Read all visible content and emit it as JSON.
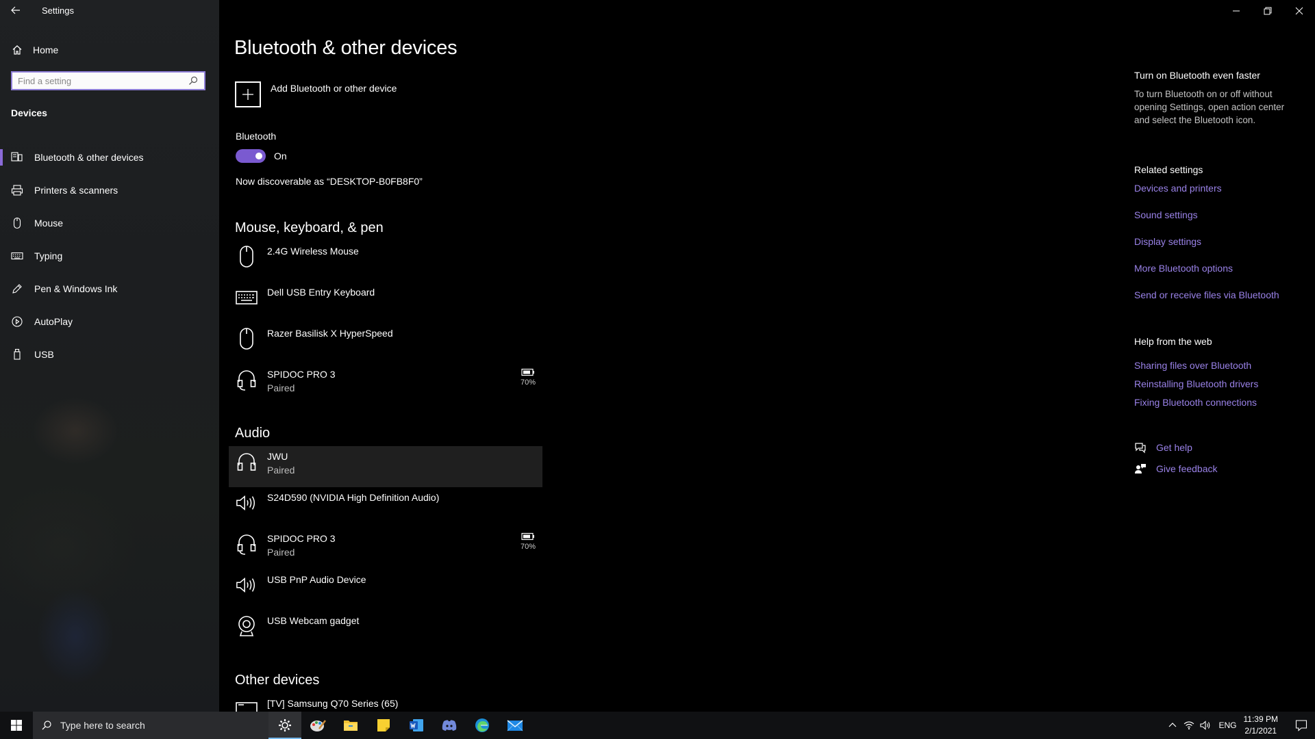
{
  "window": {
    "title": "Settings"
  },
  "sidebar": {
    "home_label": "Home",
    "search_placeholder": "Find a setting",
    "section_label": "Devices",
    "items": [
      {
        "label": "Bluetooth & other devices",
        "icon": "bluetooth-devices-icon",
        "active": true
      },
      {
        "label": "Printers & scanners",
        "icon": "printer-icon"
      },
      {
        "label": "Mouse",
        "icon": "mouse-icon"
      },
      {
        "label": "Typing",
        "icon": "keyboard-icon"
      },
      {
        "label": "Pen & Windows Ink",
        "icon": "pen-icon"
      },
      {
        "label": "AutoPlay",
        "icon": "autoplay-icon"
      },
      {
        "label": "USB",
        "icon": "usb-icon"
      }
    ]
  },
  "main": {
    "title": "Bluetooth & other devices",
    "add_device_label": "Add Bluetooth or other device",
    "bluetooth_label": "Bluetooth",
    "bluetooth_state": "On",
    "discoverable_text": "Now discoverable as “DESKTOP-B0FB8F0”",
    "groups": [
      {
        "title": "Mouse, keyboard, & pen",
        "devices": [
          {
            "name": "2.4G Wireless Mouse",
            "status": "",
            "icon": "mouse-icon"
          },
          {
            "name": "Dell USB Entry Keyboard",
            "status": "",
            "icon": "keyboard-icon"
          },
          {
            "name": "Razer Basilisk X HyperSpeed",
            "status": "",
            "icon": "mouse-icon"
          },
          {
            "name": "SPIDOC PRO 3",
            "status": "Paired",
            "icon": "headset-icon",
            "battery": "70%"
          }
        ]
      },
      {
        "title": "Audio",
        "devices": [
          {
            "name": "JWU",
            "status": "Paired",
            "icon": "headphones-icon"
          },
          {
            "name": "S24D590 (NVIDIA High Definition Audio)",
            "status": "",
            "icon": "speaker-icon"
          },
          {
            "name": "SPIDOC PRO 3",
            "status": "Paired",
            "icon": "headset-icon",
            "battery": "70%"
          },
          {
            "name": "USB PnP Audio Device",
            "status": "",
            "icon": "speaker-icon"
          },
          {
            "name": "USB Webcam gadget",
            "status": "",
            "icon": "webcam-icon"
          }
        ]
      },
      {
        "title": "Other devices",
        "devices": [
          {
            "name": "[TV] Samsung Q70 Series (65)",
            "status": "",
            "icon": "tv-icon"
          }
        ]
      }
    ]
  },
  "right_panel": {
    "tip_title": "Turn on Bluetooth even faster",
    "tip_text": "To turn Bluetooth on or off without opening Settings, open action center and select the Bluetooth icon.",
    "related_title": "Related settings",
    "related_links": [
      "Devices and printers",
      "Sound settings",
      "Display settings",
      "More Bluetooth options",
      "Send or receive files via Bluetooth"
    ],
    "help_title": "Help from the web",
    "help_links": [
      "Sharing files over Bluetooth",
      "Reinstalling Bluetooth drivers",
      "Fixing Bluetooth connections"
    ],
    "get_help_label": "Get help",
    "give_feedback_label": "Give feedback"
  },
  "taskbar": {
    "search_placeholder": "Type here to search",
    "apps": [
      "settings-icon",
      "paint-icon",
      "file-explorer-icon",
      "sticky-notes-icon",
      "word-icon",
      "discord-icon",
      "edge-icon",
      "mail-icon"
    ],
    "language": "ENG",
    "time": "11:39 PM",
    "date": "2/1/2021"
  },
  "colors": {
    "accent": "#8a6ad8",
    "link": "#9a82e8",
    "toggle_on": "#7a5ad0",
    "background": "#000000",
    "sidebar": "#1e2022",
    "taskbar": "#101113"
  }
}
